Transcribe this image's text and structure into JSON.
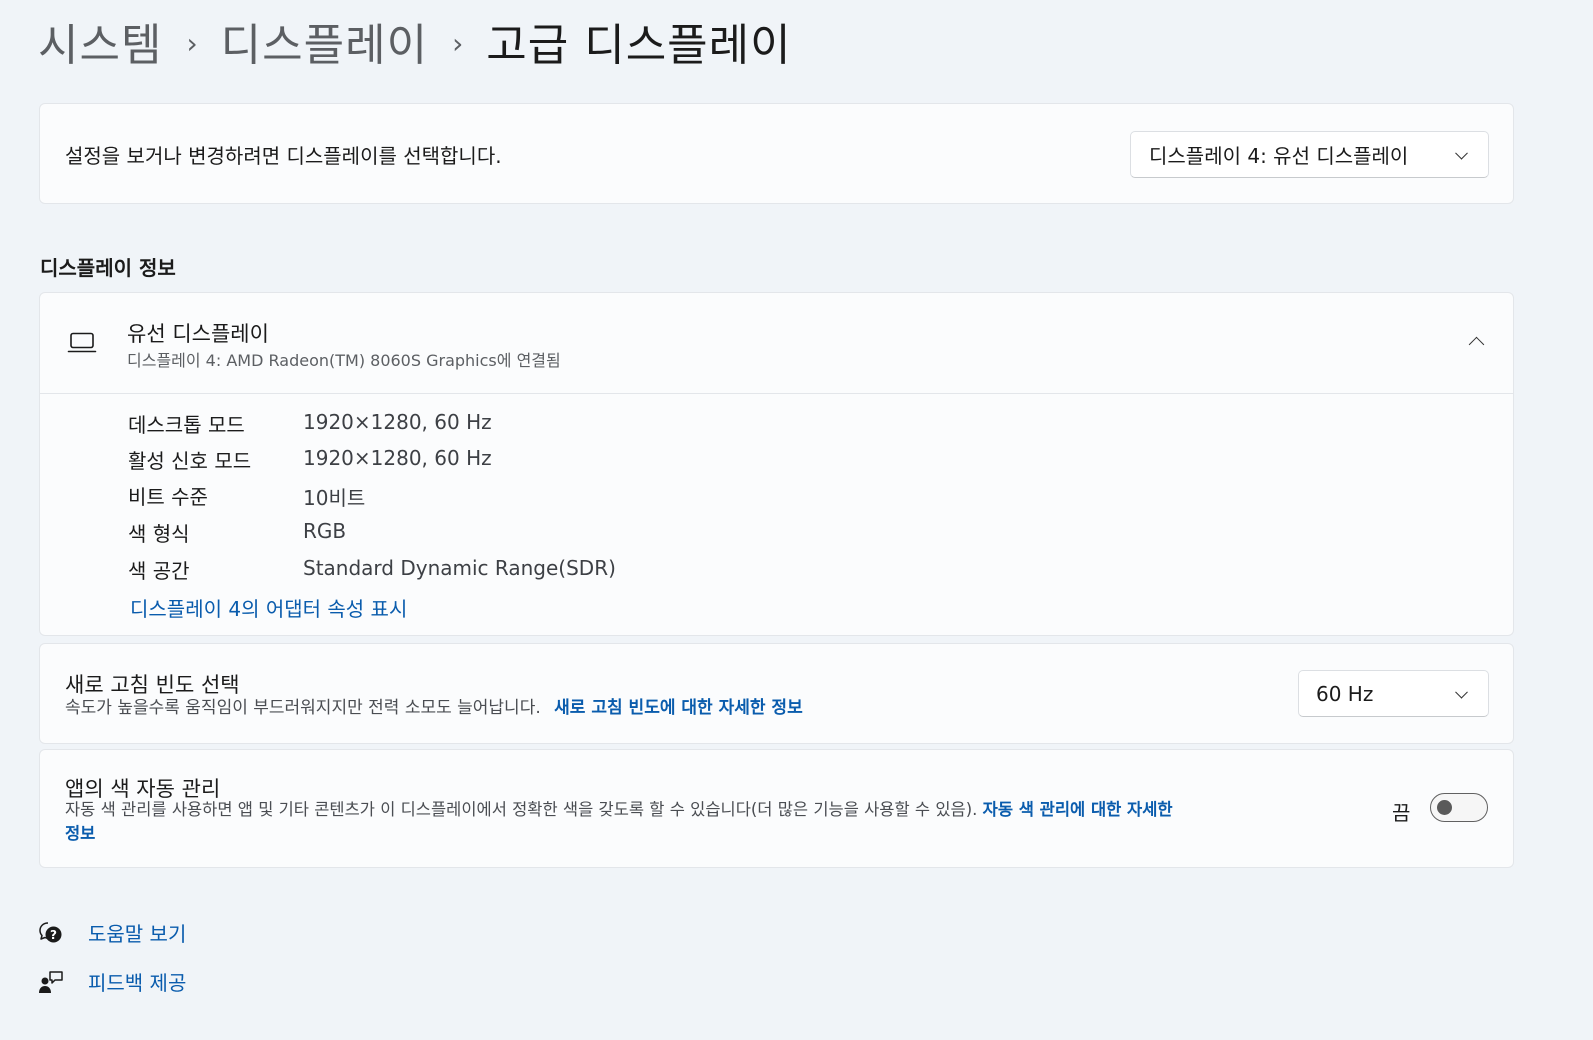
{
  "breadcrumb": {
    "items": [
      "시스템",
      "디스플레이"
    ],
    "current": "고급 디스플레이",
    "separator": "›"
  },
  "display_select": {
    "prompt": "설정을 보거나 변경하려면 디스플레이를 선택합니다.",
    "selected": "디스플레이 4: 유선 디스플레이"
  },
  "display_info": {
    "section_title": "디스플레이 정보",
    "icon": "laptop-icon",
    "name": "유선 디스플레이",
    "subtitle": "디스플레이 4: AMD Radeon(TM) 8060S Graphics에 연결됨",
    "specs": [
      {
        "label": "데스크톱 모드",
        "value": "1920×1280, 60 Hz"
      },
      {
        "label": "활성 신호 모드",
        "value": "1920×1280, 60 Hz"
      },
      {
        "label": "비트 수준",
        "value": "10비트"
      },
      {
        "label": "색 형식",
        "value": "RGB"
      },
      {
        "label": "색 공간",
        "value": "Standard Dynamic Range(SDR)"
      }
    ],
    "adapter_link": "디스플레이 4의 어댑터 속성 표시"
  },
  "refresh_rate": {
    "title": "새로 고침 빈도 선택",
    "description": "속도가 높을수록 움직임이 부드러워지지만 전력 소모도 늘어납니다.",
    "link": "새로 고침 빈도에 대한 자세한 정보",
    "selected": "60 Hz"
  },
  "auto_color": {
    "title": "앱의 색 자동 관리",
    "description_line1": "자동 색 관리를 사용하면 앱 및 기타 콘텐츠가 이 디스플레이에서 정확한 색을 갖도록 할 수 있습니다(더 많은 기능을 사용할 수 있음).",
    "link_line1": "자동 색 관리에 대한 자세한",
    "link_line2": "정보",
    "toggle_label": "끔",
    "toggle_on": false
  },
  "footer": {
    "help": "도움말 보기",
    "feedback": "피드백 제공"
  },
  "colors": {
    "accent_link": "#0a5cad",
    "background": "#f0f4f8",
    "card": "#fbfcfd"
  }
}
